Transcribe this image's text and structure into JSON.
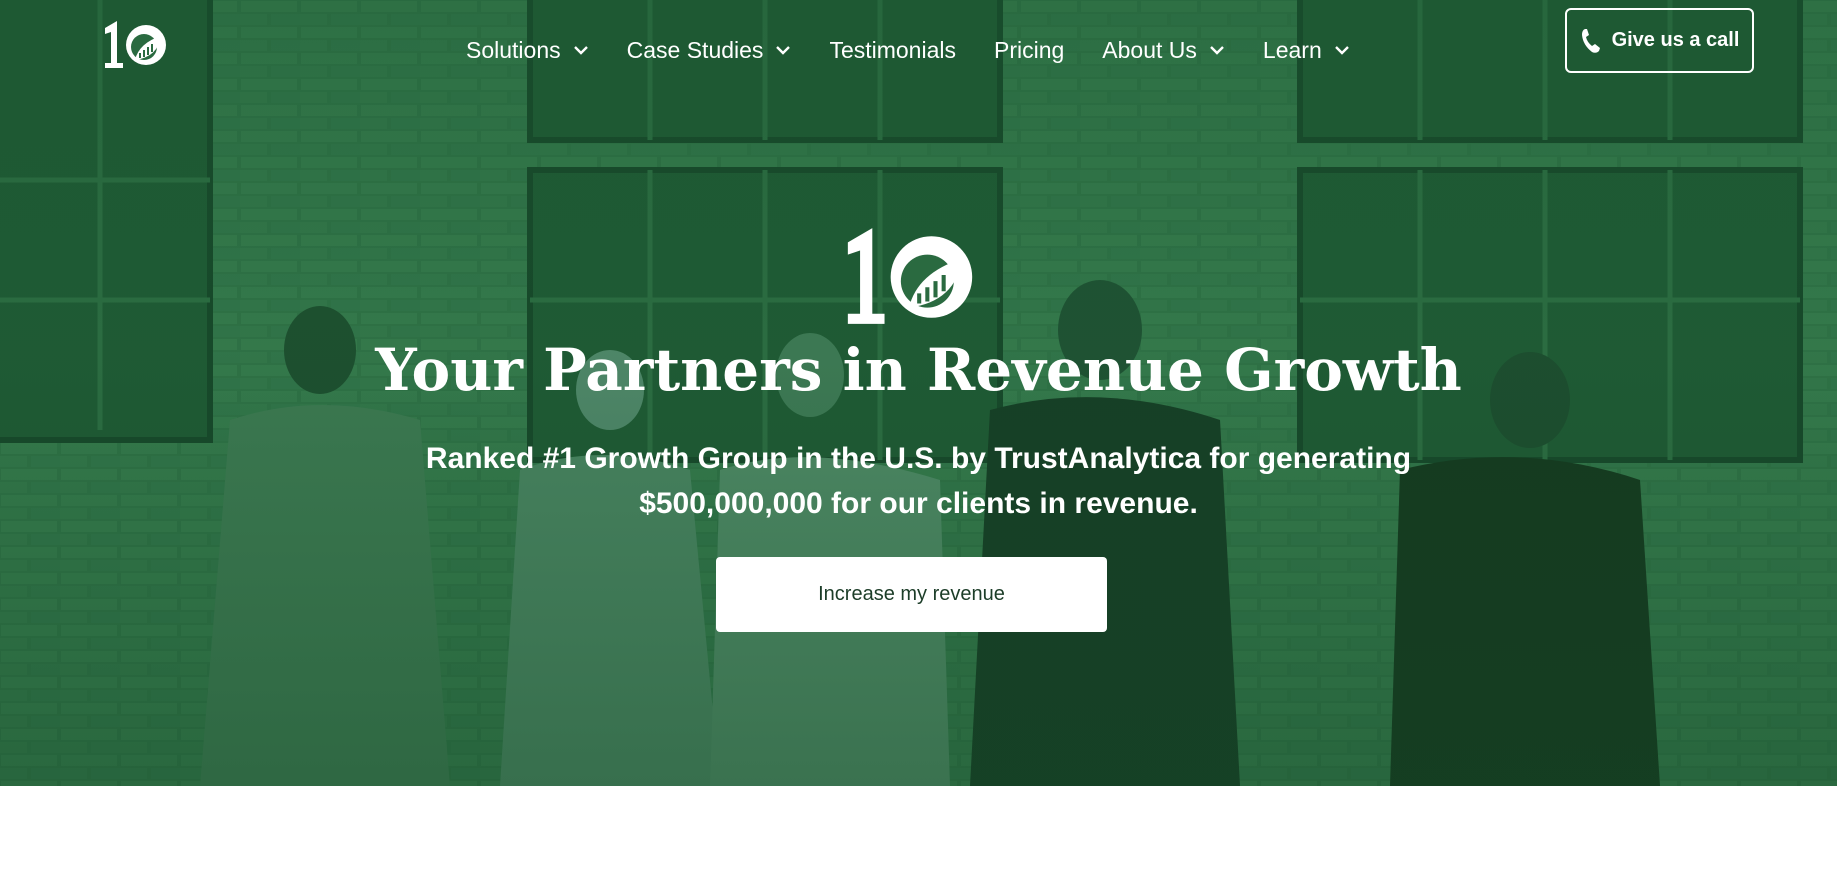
{
  "colors": {
    "hero_green": "#2a6a40",
    "text_white": "#ffffff",
    "cta_text": "#1c3d28"
  },
  "header": {
    "logo_icon": "ten-leaf-logo-icon",
    "nav": [
      {
        "label": "Solutions",
        "has_dropdown": true
      },
      {
        "label": "Case Studies",
        "has_dropdown": true
      },
      {
        "label": "Testimonials",
        "has_dropdown": false
      },
      {
        "label": "Pricing",
        "has_dropdown": false
      },
      {
        "label": "About Us",
        "has_dropdown": true
      },
      {
        "label": "Learn",
        "has_dropdown": true
      }
    ],
    "call_button": {
      "label": "Give us a call",
      "icon": "phone-icon"
    }
  },
  "hero": {
    "logo_icon": "ten-leaf-logo-icon",
    "headline": "Your Partners in Revenue Growth",
    "subline": [
      "Ranked #1 Growth Group in the U.S. by TrustAnalytica for generating",
      "$500,000,000 for our clients in revenue."
    ],
    "cta_label": "Increase my revenue"
  }
}
